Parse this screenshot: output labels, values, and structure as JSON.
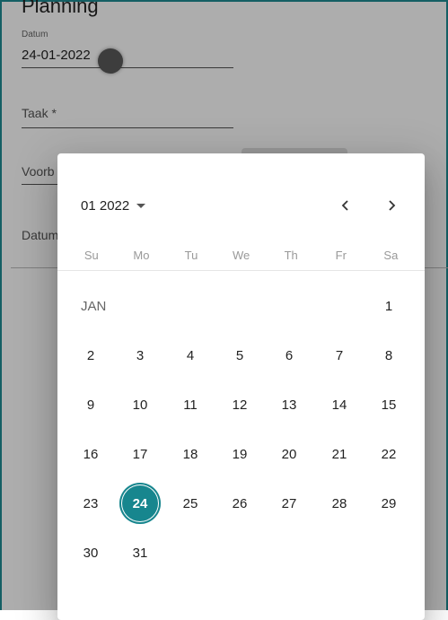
{
  "form": {
    "title": "Planning",
    "date_field": {
      "label": "Datum",
      "value": "24-01-2022"
    },
    "task_field": {
      "placeholder": "Taak *"
    },
    "field3_placeholder": "Voorb",
    "field4_label": "Datum"
  },
  "datepicker": {
    "period_label": "01 2022",
    "prev_icon": "chevron-left-icon",
    "next_icon": "chevron-right-icon",
    "weekdays": [
      "Su",
      "Mo",
      "Tu",
      "We",
      "Th",
      "Fr",
      "Sa"
    ],
    "month_label": "JAN",
    "days": [
      "1",
      "2",
      "3",
      "4",
      "5",
      "6",
      "7",
      "8",
      "9",
      "10",
      "11",
      "12",
      "13",
      "14",
      "15",
      "16",
      "17",
      "18",
      "19",
      "20",
      "21",
      "22",
      "23",
      "24",
      "25",
      "26",
      "27",
      "28",
      "29",
      "30",
      "31"
    ],
    "selected_day": "24",
    "accent_color": "#17868e"
  }
}
